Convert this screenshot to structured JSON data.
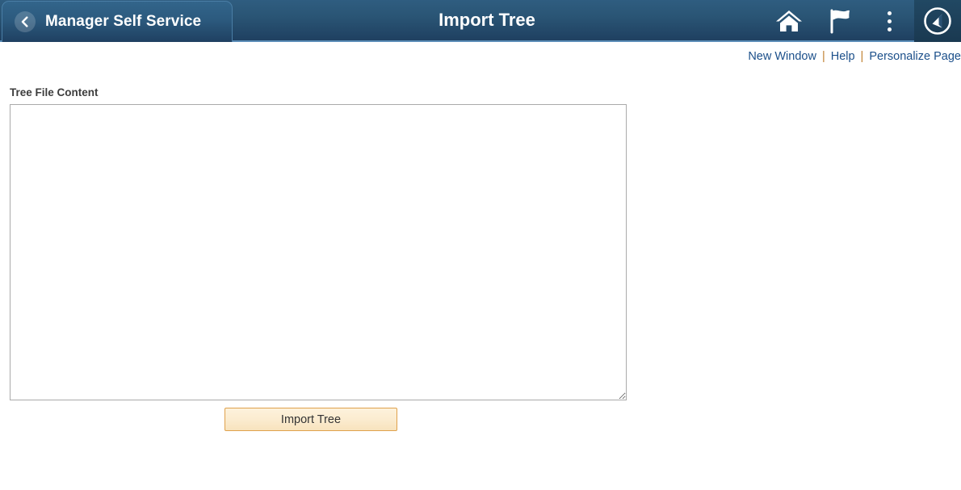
{
  "header": {
    "back_label": "Manager Self Service",
    "back_icon": "chevron-left-icon",
    "title": "Import Tree",
    "icons": [
      {
        "name": "home-icon",
        "label": "Home"
      },
      {
        "name": "flag-icon",
        "label": "Notifications"
      },
      {
        "name": "actions-menu-icon",
        "label": "Actions"
      },
      {
        "name": "navbar-compass-icon",
        "label": "NavBar"
      }
    ],
    "colors": {
      "gradient_top": "#2f5d80",
      "gradient_bottom": "#1f4061",
      "accent_rule": "#5b8db8",
      "navbar_box": "#214863"
    }
  },
  "page_links": {
    "new_window": "New Window",
    "help": "Help",
    "personalize": "Personalize Page",
    "separator": "|",
    "link_color": "#1b4f8a",
    "separator_color": "#c08030"
  },
  "main": {
    "field_label": "Tree File Content",
    "textarea": {
      "value": "",
      "placeholder": ""
    },
    "import_button": {
      "label": "Import Tree",
      "bg_color": "#fbecd0",
      "border_color": "#dfa14c"
    }
  }
}
